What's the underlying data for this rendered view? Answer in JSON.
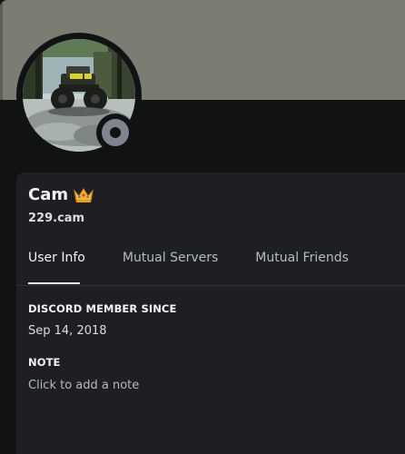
{
  "profile": {
    "display_name": "Cam",
    "username": "229.cam",
    "badge_icon": "crown-icon",
    "status": "offline",
    "banner_color": "#7b7d72",
    "avatar_icon": "avatar-offroad-truck"
  },
  "tabs": [
    {
      "label": "User Info",
      "active": true
    },
    {
      "label": "Mutual Servers",
      "active": false
    },
    {
      "label": "Mutual Friends",
      "active": false
    }
  ],
  "user_info": {
    "member_since_header": "DISCORD MEMBER SINCE",
    "member_since_value": "Sep 14, 2018",
    "note_header": "NOTE",
    "note_placeholder": "Click to add a note"
  }
}
